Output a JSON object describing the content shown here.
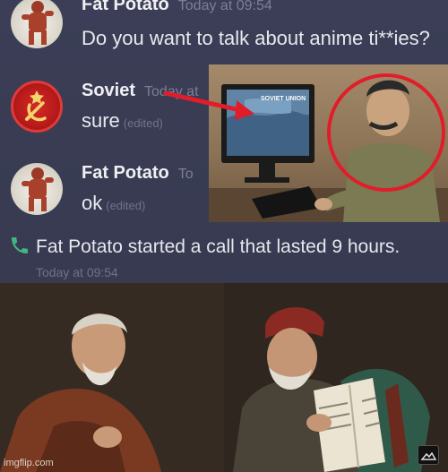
{
  "chat": {
    "messages": [
      {
        "author": "Fat Potato",
        "timestamp": "Today at 09:54",
        "text": "Do you want to talk about anime ti**ies?",
        "edited": ""
      },
      {
        "author": "Soviet",
        "timestamp": "Today at",
        "text": "sure",
        "edited": "(edited)"
      },
      {
        "author": "Fat Potato",
        "timestamp": "To",
        "text": "ok",
        "edited": "(edited)"
      }
    ],
    "call": {
      "text": "Fat Potato started a call that lasted 9 hours.",
      "timestamp": "Today at 09:54",
      "icon": "phone-icon"
    }
  },
  "inset": {
    "screen_text": "SOVIET UNION"
  },
  "footer": {
    "watermark": "imgflip.com"
  },
  "colors": {
    "chat_bg": "#3a3d54",
    "call_icon": "#43b581",
    "highlight_ring": "#e11d2b"
  }
}
